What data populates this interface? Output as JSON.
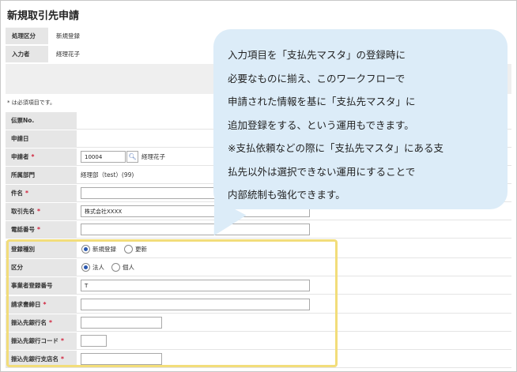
{
  "page": {
    "title": "新規取引先申請"
  },
  "header_fields": [
    {
      "label": "処理区分",
      "value": "新規登録"
    },
    {
      "label": "入力者",
      "value": "経理花子"
    }
  ],
  "required_note": "* は必須項目です。",
  "form": {
    "denpyo_no": {
      "label": "伝票No.",
      "value": ""
    },
    "apply_date": {
      "label": "申請日",
      "value": ""
    },
    "applicant": {
      "label": "申請者",
      "required": "*",
      "code": "10004",
      "name": "経理花子"
    },
    "department": {
      "label": "所属部門",
      "value": "経理部（test）(99)"
    },
    "subject": {
      "label": "件名",
      "required": "*",
      "value": ""
    },
    "partner_name": {
      "label": "取引先名",
      "required": "*",
      "value": "株式会社XXXX"
    },
    "phone": {
      "label": "電話番号",
      "required": "*",
      "value": ""
    },
    "reg_type": {
      "label": "登録種別",
      "options": [
        "新規登録",
        "更新"
      ],
      "selected": "新規登録"
    },
    "category": {
      "label": "区分",
      "options": [
        "法人",
        "個人"
      ],
      "selected": "法人"
    },
    "business_reg_no": {
      "label": "事業者登録番号",
      "value": "T"
    },
    "closing_day": {
      "label": "請求書締日",
      "required": "*",
      "value": ""
    },
    "bank_name": {
      "label": "振込先銀行名",
      "required": "*",
      "value": ""
    },
    "bank_code": {
      "label": "振込先銀行コード",
      "required": "*",
      "value": ""
    },
    "branch_name": {
      "label": "振込先銀行支店名",
      "required": "*",
      "value": ""
    }
  },
  "callout": {
    "lines": [
      "入力項目を「支払先マスタ」の登録時に",
      "必要なものに揃え、このワークフローで",
      "申請された情報を基に「支払先マスタ」に",
      "追加登録をする、という運用もできます。",
      "※支払依頼などの際に「支払先マスタ」にある支",
      "払先以外は選択できない運用にすることで",
      "内部統制も強化できます。"
    ]
  },
  "colors": {
    "required": "#d0203a",
    "highlight": "#f2dd7a",
    "callout_bg": "#dcecf8",
    "label_bg": "#e6e6e6"
  }
}
